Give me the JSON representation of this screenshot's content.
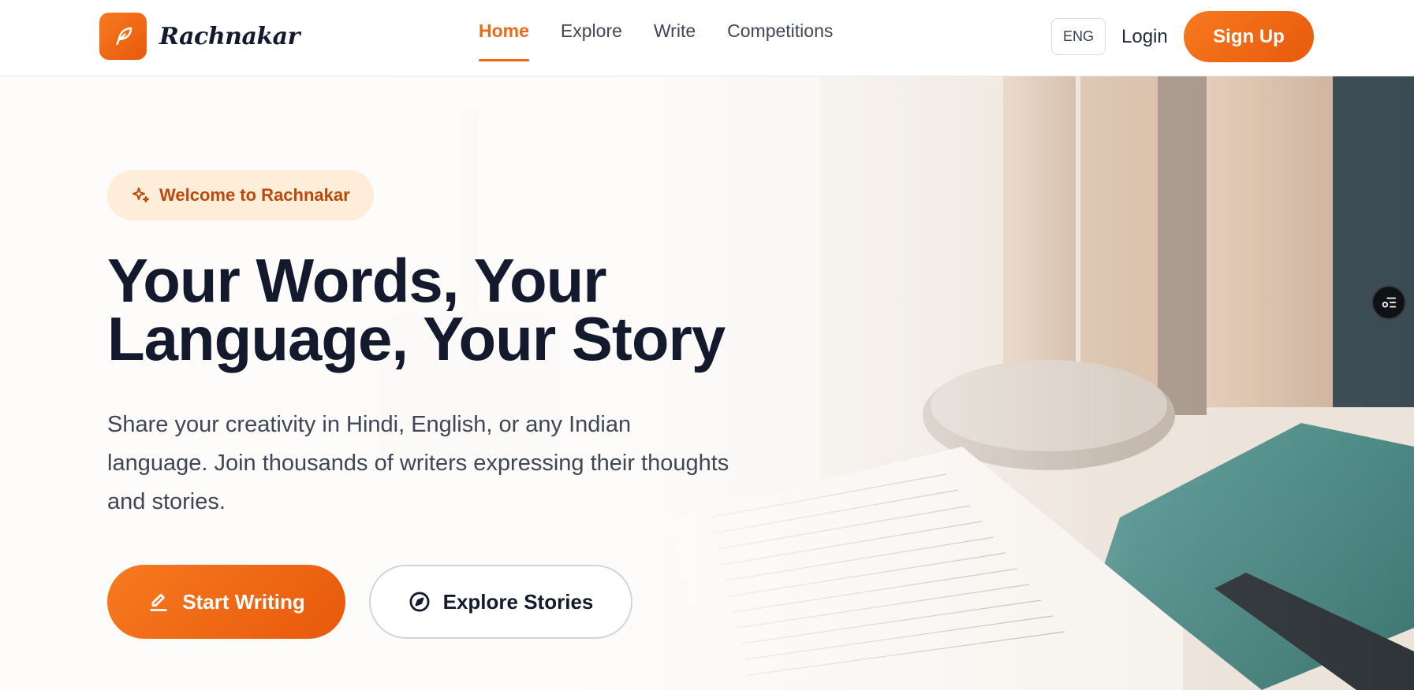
{
  "header": {
    "brand_name": "Rachnakar",
    "nav": [
      {
        "label": "Home",
        "active": true
      },
      {
        "label": "Explore",
        "active": false
      },
      {
        "label": "Write",
        "active": false
      },
      {
        "label": "Competitions",
        "active": false
      }
    ],
    "language_label": "ENG",
    "login_label": "Login",
    "signup_label": "Sign Up"
  },
  "hero": {
    "badge_label": "Welcome to Rachnakar",
    "title_line1": "Your Words, Your",
    "title_line2": "Language, Your Story",
    "subtitle": "Share your creativity in Hindi, English, or any Indian language. Join thousands of writers expressing their thoughts and stories.",
    "primary_cta": "Start Writing",
    "secondary_cta": "Explore Stories"
  },
  "icons": {
    "logo": "feather-icon",
    "badge": "sparkles-icon",
    "primary_cta": "pencil-icon",
    "secondary_cta": "compass-icon",
    "floating_tool": "list-settings-icon"
  },
  "colors": {
    "accent": "#ea6a17",
    "accent_gradient_start": "#f77a1f",
    "accent_gradient_end": "#e8590c",
    "badge_bg": "#feedd9",
    "badge_text": "#b94a0c",
    "heading": "#141a2e",
    "body_text": "#3f4654"
  }
}
